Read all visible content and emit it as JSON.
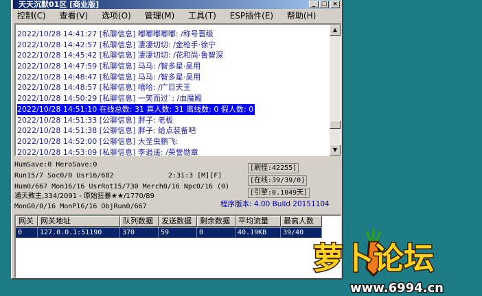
{
  "window": {
    "title": "天天沉默01区 [商业版]",
    "buttons": {
      "min": "_",
      "max": "□",
      "close": "×"
    }
  },
  "menu": [
    {
      "label": "控制(C)"
    },
    {
      "label": "查看(V)"
    },
    {
      "label": "选项(O)"
    },
    {
      "label": "管理(M)"
    },
    {
      "label": "工具(T)"
    },
    {
      "label": "ESP插件(E)"
    },
    {
      "label": "帮助(H)"
    }
  ],
  "log": [
    {
      "text": "2022/10/28 14:41:27 [私聊信息] 嘟嘟嘟嘟嘟: /称号晋级"
    },
    {
      "text": "2022/10/28 14:42:57 [私聊信息] 凄凄切切: /金枪手·徐宁"
    },
    {
      "text": "2022/10/28 14:45:42 [私聊信息] 凄凄切切: /花和尚·鲁智深"
    },
    {
      "text": "2022/10/28 14:47:59 [私聊信息] 马马: /智多星·吴用"
    },
    {
      "text": "2022/10/28 14:48:47 [私聊信息] 马马: /智多星·吴用"
    },
    {
      "text": "2022/10/28 14:48:57 [私聊信息] 嘻哈: /广目天王"
    },
    {
      "text": "2022/10/28 14:50:29 [私聊信息] 一笑而过`: /血魔殿"
    },
    {
      "text": "2022/10/28 14:51:10 在线总数: 31 真人数: 31 离线数: 0 假人数: 0",
      "selected": true
    },
    {
      "text": "2022/10/28 14:51:33 [公聊信息] 胖子: 老板"
    },
    {
      "text": "2022/10/28 14:51:38 [公聊信息] 胖子: 给点装备吧"
    },
    {
      "text": "2022/10/28 14:52:00 [公聊信息] 大圣虫鹏飞:"
    },
    {
      "text": "2022/10/28 14:53:09 [私聊信息] 李逍遥: /荣誉勋章"
    }
  ],
  "stats": {
    "line1": "HumSave:0 HeroSave:0",
    "line2": "Run15/7 Soc0/0 Usr16/682",
    "runtime": "2:31:3 [M][F]",
    "line3": "Hum0/667 Mon16/16 UsrRot15/730 Merch0/16 Npc0/16 (0)",
    "line4": "通天教主,334/2091 - 原始狂暴★★/1770/89",
    "line5": "MonG0/0/16 MonP16/16 ObjRun0/667",
    "brush": "[刷怪:42255]",
    "online": "[在线:39/39/0]",
    "engine": "[引擎:0.1049天]",
    "version": "程序版本: 4.00 Build 20151104"
  },
  "gateway_table": {
    "columns": [
      "网关",
      "网关地址",
      "队列数据",
      "发送数据",
      "剩余数据",
      "平均流量",
      "最高人数"
    ],
    "rows": [
      [
        "0",
        "127.0.0.1:51190",
        "370",
        "59",
        "0",
        "40.19KB",
        "39/40"
      ]
    ]
  },
  "watermark": {
    "text_cn": "萝卜论坛",
    "domain": "www.6994.cn"
  },
  "colors": {
    "desktop": "#1d7c86",
    "selection": "#0000ff",
    "log_text": "#1c1ca0",
    "version_text": "#0000c0"
  }
}
